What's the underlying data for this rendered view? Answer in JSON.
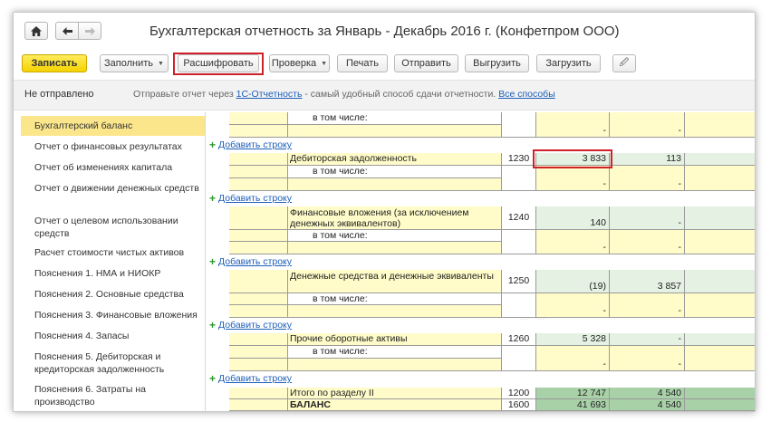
{
  "window": {
    "home_icon": "home-icon",
    "back_icon": "arrow-left-icon",
    "forward_icon": "arrow-right-icon",
    "title": "Бухгалтерская отчетность за Январь - Декабрь 2016 г. (Конфетпром ООО)"
  },
  "toolbar": {
    "save": "Записать",
    "fill": "Заполнить",
    "decode": "Расшифровать",
    "check": "Проверка",
    "print": "Печать",
    "send": "Отправить",
    "export": "Выгрузить",
    "import": "Загрузить",
    "attach_icon": "paperclip-icon",
    "attach_glyph": "🖉"
  },
  "status": {
    "state": "Не отправлено",
    "hint_prefix": "Отправьте отчет через ",
    "hint_link": "1С-Отчетность",
    "hint_middle": " - самый удобный способ сдачи отчетности. ",
    "hint_link2": "Все способы"
  },
  "sidebar": {
    "items": [
      "Бухгалтерский баланс",
      "Отчет о финансовых результатах",
      "Отчет об изменениях капитала",
      "Отчет о движении денежных средств",
      "Отчет о целевом использовании средств",
      "Расчет стоимости чистых активов",
      "Пояснения 1. НМА и НИОКР",
      "Пояснения 2. Основные средства",
      "Пояснения 3. Финансовые вложения",
      "Пояснения 4. Запасы",
      "Пояснения 5. Дебиторская и кредиторская задолженность",
      "Пояснения 6. Затраты на производство"
    ]
  },
  "grid": {
    "add_row": "Добавить строку",
    "in_total": "в том числе:",
    "dash": "-",
    "rows": [
      {
        "name": "Дебиторская задолженность",
        "code": "1230",
        "v1": "3 833",
        "v2": "113",
        "v3": "-"
      },
      {
        "name": "Финансовые вложения (за исключением денежных эквивалентов)",
        "code": "1240",
        "v1": "140",
        "v2": "-",
        "v3": "-"
      },
      {
        "name": "Денежные средства и денежные эквиваленты",
        "code": "1250",
        "v1": "(19)",
        "v2": "3 857",
        "v3": "-"
      },
      {
        "name": "Прочие оборотные активы",
        "code": "1260",
        "v1": "5 328",
        "v2": "-",
        "v3": "-"
      },
      {
        "name": "Итого по разделу II",
        "code": "1200",
        "v1": "12 747",
        "v2": "4 540",
        "v3": "-"
      },
      {
        "name": "БАЛАНС",
        "code": "1600",
        "v1": "41 693",
        "v2": "4 540",
        "v3": "-"
      }
    ]
  },
  "colors": {
    "accent_yellow": "#f5d200",
    "highlight_red": "#d0202a",
    "link_blue": "#1d5fb8",
    "sidebar_active": "#fbe68c"
  }
}
